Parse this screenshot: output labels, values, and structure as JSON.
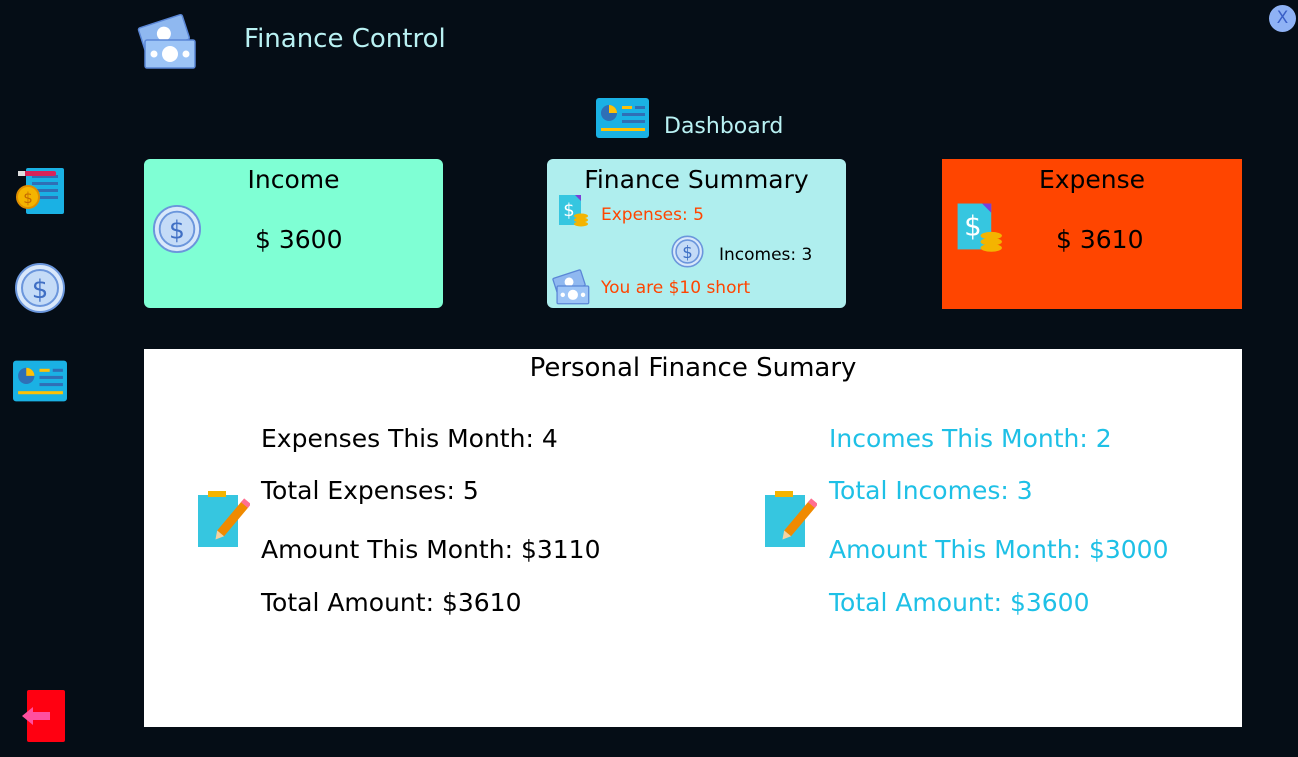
{
  "header": {
    "app_title": "Finance Control",
    "close_label": "X",
    "dashboard_label": "Dashboard"
  },
  "sidebar": {
    "items": [
      {
        "name": "expenses",
        "icon": "bill-coin-icon"
      },
      {
        "name": "incomes",
        "icon": "dollar-coin-icon"
      },
      {
        "name": "dashboard",
        "icon": "dashboard-chart-icon"
      },
      {
        "name": "logout",
        "icon": "exit-arrow-icon"
      }
    ]
  },
  "cards": {
    "income": {
      "title": "Income",
      "value": "$ 3600",
      "color": "#7fffd4"
    },
    "summary": {
      "title": "Finance Summary",
      "expenses": "Expenses: 5",
      "incomes": "Incomes: 3",
      "status": "You are $10 short",
      "color": "#afeeee"
    },
    "expense": {
      "title": "Expense",
      "value": "$ 3610",
      "color": "#ff4500"
    }
  },
  "panel": {
    "title": "Personal Finance Sumary",
    "expenses": {
      "this_month": "Expenses This Month: 4",
      "total": "Total Expenses: 5",
      "amount_month": "Amount This Month: $3110",
      "total_amount": "Total Amount: $3610"
    },
    "incomes": {
      "this_month": "Incomes This Month: 2",
      "total": "Total Incomes: 3",
      "amount_month": "Amount This Month: $3000",
      "total_amount": "Total Amount: $3600"
    },
    "accent_color": "#1ec0e6"
  }
}
